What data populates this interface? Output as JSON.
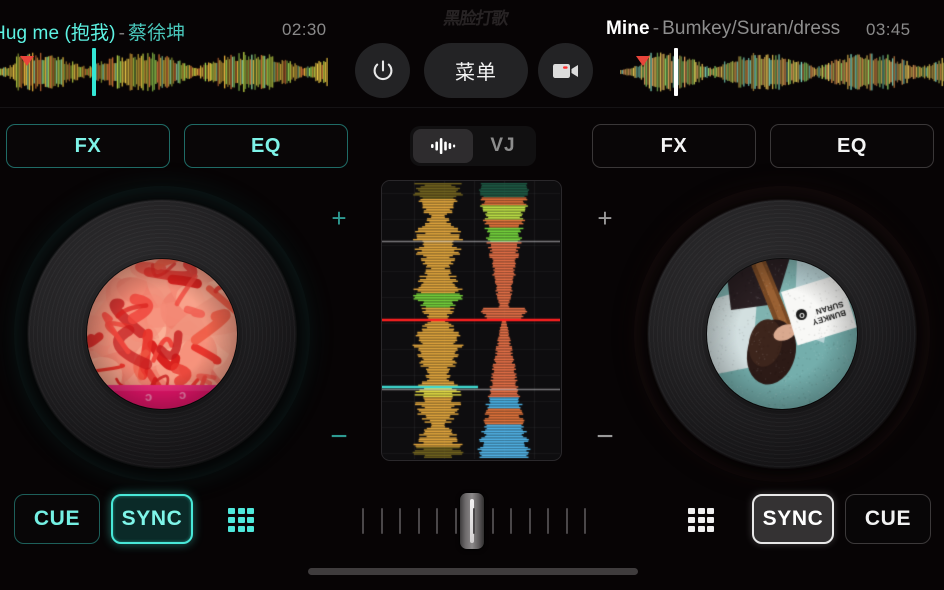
{
  "app": {
    "watermark_logo": "黑脸打歌",
    "background": "#070405"
  },
  "decks": {
    "left": {
      "id": "deck-a",
      "title": "Hug me (抱我)",
      "separator": "-",
      "artist": "蔡徐坤",
      "time": "02:30",
      "accent_color": "#5df3e3",
      "playhead_color": "#33e6d6",
      "cue_marker_color": "#e8443a",
      "fx_label": "FX",
      "eq_label": "EQ",
      "pitch_up": "+",
      "pitch_down": "−",
      "cue_label": "CUE",
      "sync_label": "SYNC",
      "sync_active": true,
      "grid_icon": "grid-3x3-icon",
      "artwork_desc": "pink-red painted hands album art"
    },
    "right": {
      "id": "deck-b",
      "title": "Mine",
      "separator": "-",
      "artist": "Bumkey/Suran/dress",
      "time": "03:45",
      "accent_color": "#ffffff",
      "playhead_color": "#ffffff",
      "cue_marker_color": "#e8443a",
      "fx_label": "FX",
      "eq_label": "EQ",
      "pitch_up": "+",
      "pitch_down": "−",
      "cue_label": "CUE",
      "sync_label": "SYNC",
      "sync_active": true,
      "grid_icon": "grid-3x3-icon",
      "artwork_desc": "teal bathroom scene with BUMKEY SURAN card",
      "artwork_card_line1": "BUMKEY",
      "artwork_card_line2": "SURAN"
    }
  },
  "center": {
    "power_button": "power-icon",
    "menu_label": "菜单",
    "camera_button": "video-camera-icon",
    "camera_rec_color": "#ff2d2d",
    "view_tabs": [
      {
        "label": "",
        "icon": "waveform-icon",
        "active": true
      },
      {
        "label": "VJ",
        "icon": "",
        "active": false
      }
    ],
    "waveform_panel": {
      "playhead_color": "#ff2020",
      "marker_color": "#3fd8cf",
      "left_wave_color": "#f5b441",
      "right_wave_color": "#f2764a"
    },
    "crossfader": {
      "position_percent": 50,
      "tick_count": 13
    }
  },
  "system": {
    "home_indicator": true
  }
}
